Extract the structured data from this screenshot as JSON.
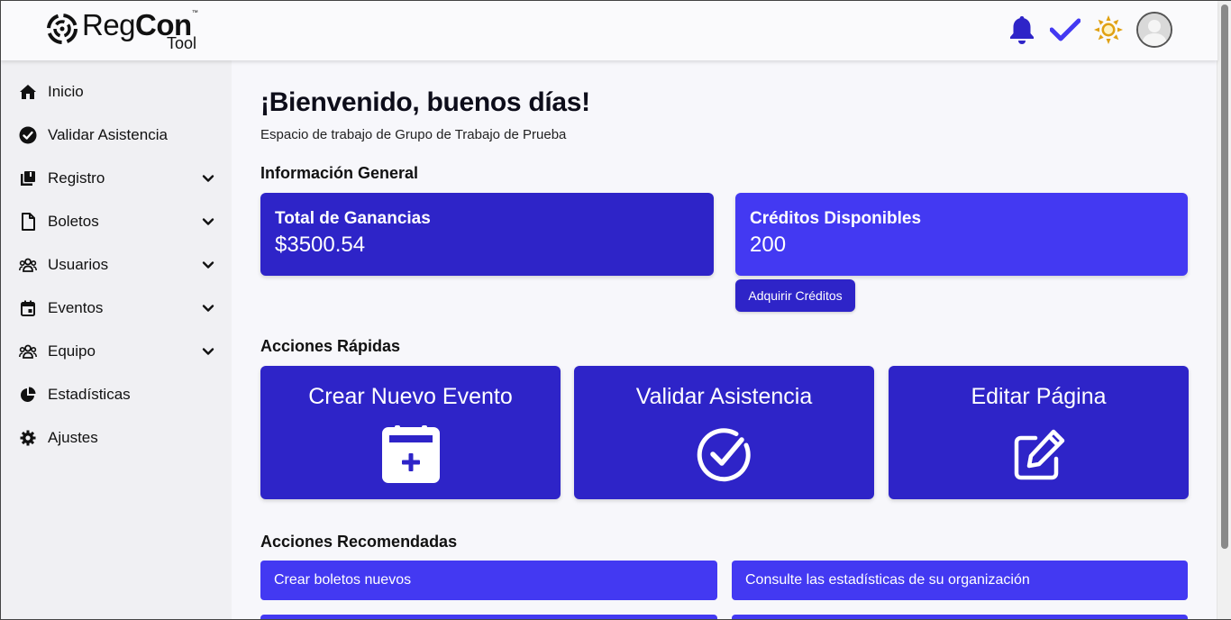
{
  "brand": {
    "name_regular": "Reg",
    "name_bold": "Con",
    "trademark": "™",
    "subtitle": "Tool"
  },
  "header_icons": [
    "bell-icon",
    "check-icon",
    "sun-icon",
    "user-avatar"
  ],
  "sidebar": {
    "items": [
      {
        "label": "Inicio",
        "icon": "home-icon",
        "expandable": false
      },
      {
        "label": "Validar Asistencia",
        "icon": "check-circle-icon",
        "expandable": false
      },
      {
        "label": "Registro",
        "icon": "book-icon",
        "expandable": true
      },
      {
        "label": "Boletos",
        "icon": "file-icon",
        "expandable": true
      },
      {
        "label": "Usuarios",
        "icon": "users-icon",
        "expandable": true
      },
      {
        "label": "Eventos",
        "icon": "calendar-icon",
        "expandable": true
      },
      {
        "label": "Equipo",
        "icon": "team-icon",
        "expandable": true
      },
      {
        "label": "Estadísticas",
        "icon": "pie-chart-icon",
        "expandable": false
      },
      {
        "label": "Ajustes",
        "icon": "gear-icon",
        "expandable": false
      }
    ]
  },
  "main": {
    "welcome": "¡Bienvenido, buenos días!",
    "workspace": "Espacio de trabajo de Grupo de Trabajo de Prueba",
    "general_info": {
      "title": "Información General",
      "earnings": {
        "title": "Total de Ganancias",
        "value": "$3500.54"
      },
      "credits": {
        "title": "Créditos Disponibles",
        "value": "200",
        "button": "Adquirir Créditos"
      }
    },
    "quick_actions": {
      "title": "Acciones Rápidas",
      "items": [
        {
          "label": "Crear Nuevo Evento",
          "icon": "calendar-plus-icon"
        },
        {
          "label": "Validar Asistencia",
          "icon": "check-circle-icon"
        },
        {
          "label": "Editar Página",
          "icon": "edit-icon"
        }
      ]
    },
    "recommended": {
      "title": "Acciones Recomendadas",
      "items": [
        {
          "label": "Crear boletos nuevos"
        },
        {
          "label": "Consulte las estadísticas de su organización"
        }
      ]
    }
  },
  "colors": {
    "primary_dark": "#2e24c8",
    "primary": "#4339f2",
    "bell": "#2e24c8",
    "check": "#4339f2",
    "sun": "#e0a112"
  }
}
